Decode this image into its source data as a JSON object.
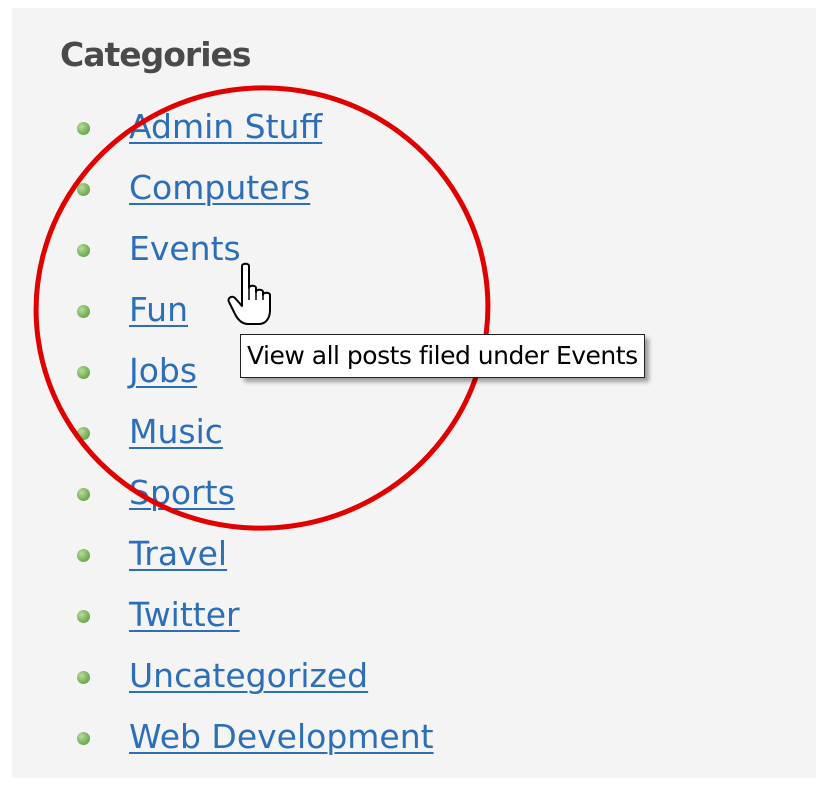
{
  "widget": {
    "heading": "Categories",
    "categories": [
      {
        "label": "Admin Stuff"
      },
      {
        "label": "Computers"
      },
      {
        "label": "Events"
      },
      {
        "label": "Fun"
      },
      {
        "label": "Jobs"
      },
      {
        "label": "Music"
      },
      {
        "label": "Sports"
      },
      {
        "label": "Travel"
      },
      {
        "label": "Twitter"
      },
      {
        "label": "Uncategorized"
      },
      {
        "label": "Web Development"
      }
    ],
    "hovered_item": "Events",
    "tooltip": "View all posts filed under Events"
  },
  "colors": {
    "link": "#2d6eb8",
    "heading": "#4a4a4a",
    "panel_background": "#f4f4f4",
    "bullet": "#7bb35b",
    "annotation_circle": "#e00000"
  },
  "icons": {
    "bullet": "green-dot-icon",
    "cursor": "hand-pointer-cursor-icon"
  }
}
